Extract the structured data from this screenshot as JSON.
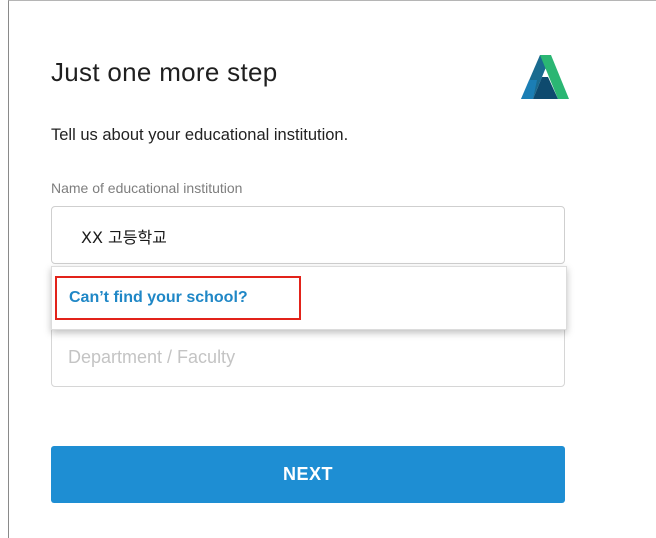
{
  "header": {
    "title": "Just one more step",
    "logo_icon": "autodesk-logo-icon",
    "logo_colors": [
      "#1a6b8f",
      "#2bb673",
      "#0e4a6e"
    ]
  },
  "form": {
    "subtitle": "Tell us about your educational institution.",
    "institution": {
      "label": "Name of educational institution",
      "value": "XX 고등학교"
    },
    "suggestions": {
      "cant_find_label": "Can’t find your school?"
    },
    "department": {
      "placeholder": "Department / Faculty",
      "value": ""
    },
    "next_label": "NEXT"
  },
  "colors": {
    "accent": "#1e8ed3",
    "link": "#1f87c6",
    "highlight": "#e2231a"
  }
}
